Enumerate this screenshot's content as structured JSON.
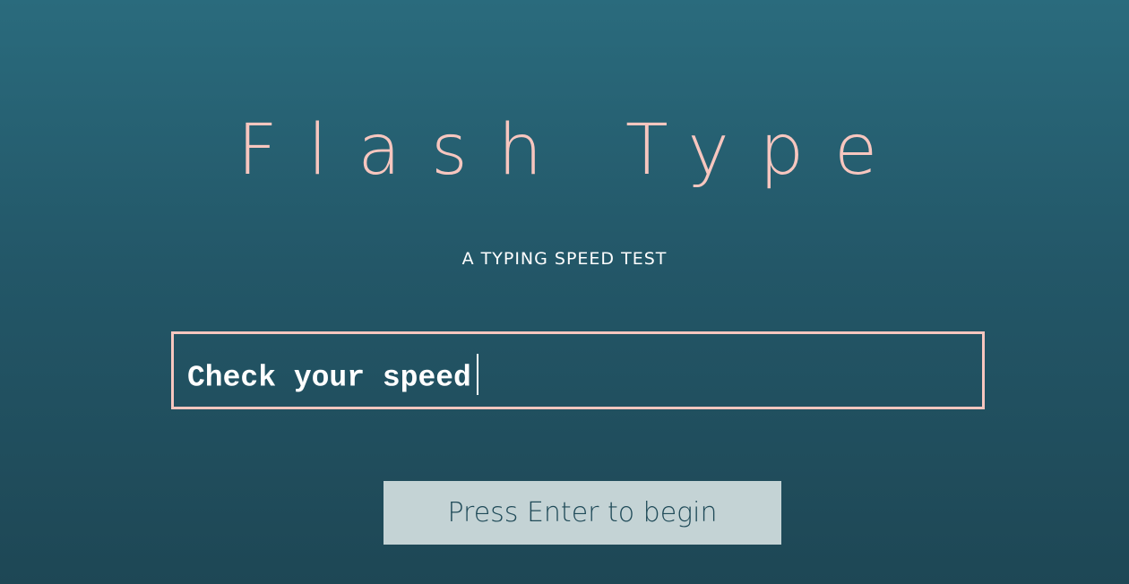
{
  "app": {
    "title": "Flash Type",
    "subtitle": "A TYPING SPEED TEST"
  },
  "input": {
    "value": "Check your speed"
  },
  "start_button": {
    "label": "Press Enter to begin"
  },
  "colors": {
    "background_top": "#2a6b7d",
    "background_bottom": "#1e4755",
    "accent": "#f7c6bf",
    "button_bg": "#c4d3d5",
    "button_text": "#1f4a58"
  }
}
